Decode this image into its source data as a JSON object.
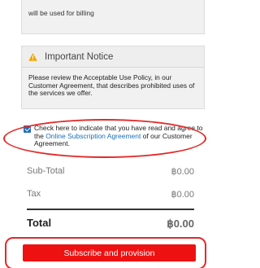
{
  "billing": {
    "text": "will be used for billing"
  },
  "notice": {
    "icon": "warning-icon",
    "title": "Important Notice",
    "body": "Please review the Acceptable Use Policy, in our Customer Agreement, that describes prohibited uses of the services we offer."
  },
  "agreement": {
    "checked": true,
    "text_before": "Check here to indicate that you have read and agree to the ",
    "link_text": "Online Subscription Agreement",
    "text_after": " of our Customer Agreement."
  },
  "summary": {
    "subtotal_label": "Sub-Total",
    "subtotal_value": "฿0.00",
    "tax_label": "Tax",
    "tax_value": "฿0.00",
    "total_label": "Total",
    "total_value": "฿0.00"
  },
  "actions": {
    "subscribe_label": "Subscribe and provision"
  },
  "colors": {
    "accent": "#ee1111",
    "highlight": "#e32a2a",
    "link": "#1a6fb8",
    "warning": "#f0a500"
  }
}
